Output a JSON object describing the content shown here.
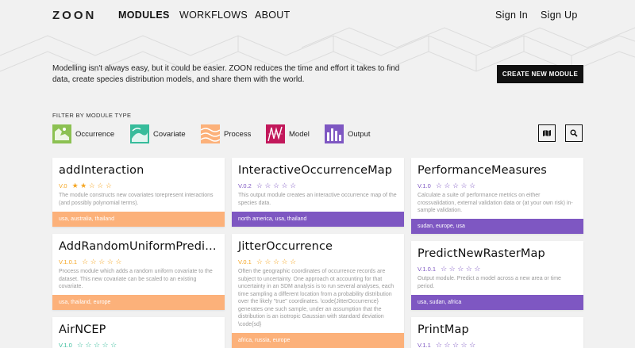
{
  "brand": "ZOON",
  "nav": {
    "modules": "MODULES",
    "workflows": "WORKFLOWS",
    "about": "ABOUT",
    "sign_in": "Sign In",
    "sign_up": "Sign Up"
  },
  "intro": "Modelling isn't always easy, but it could be easier. ZOON reduces the time and effort it takes to find data, create species distribution models, and share them with the world.",
  "create_button": "CREATE NEW MODULE",
  "filter": {
    "title": "FILTER BY MODULE TYPE",
    "types": [
      {
        "label": "Occurrence",
        "color": "#8cc152",
        "icon": "occurrence-icon"
      },
      {
        "label": "Covariate",
        "color": "#37bc9b",
        "icon": "covariate-icon"
      },
      {
        "label": "Process",
        "color": "#fcb17a",
        "icon": "process-icon"
      },
      {
        "label": "Model",
        "color": "#c2185b",
        "icon": "model-icon"
      },
      {
        "label": "Output",
        "color": "#7e57c2",
        "icon": "output-icon"
      }
    ]
  },
  "tools": {
    "map_icon": "map-icon",
    "search_icon": "search-icon"
  },
  "colors": {
    "process": "#fcb17a",
    "output": "#7e57c2",
    "star_process": "#f5a623",
    "star_output": "#7e57c2",
    "star_covariate": "#37bc9b"
  },
  "cards": [
    {
      "title": "addInteraction",
      "version": "V.0",
      "stars": "★★☆☆☆",
      "description": "The module constructs new covariates torepresent interactions (and possibly polynomial terms).",
      "tags": "usa, australia, thailand"
    },
    {
      "title": "AddRandomUniformPredi…",
      "version": "V.1.0.1",
      "stars": "☆☆☆☆☆",
      "description": "Process module which adds a random uniform covariate to the dataset. This new covariate can be scaled to an existing covariate.",
      "tags": "usa, thailand, europe"
    },
    {
      "title": "AirNCEP",
      "version": "V.1.0",
      "stars": "☆☆☆☆☆",
      "description": "",
      "tags": ""
    },
    {
      "title": "InteractiveOccurrenceMap",
      "version": "V.0.2",
      "stars": "☆☆☆☆☆",
      "description": "This output module creates an interactive occurrence map of the species data.",
      "tags": "north america, usa, thailand"
    },
    {
      "title": "JitterOccurrence",
      "version": "V.0.1",
      "stars": "☆☆☆☆☆",
      "description": "Often the geographic coordinates of occurrence records are subject to uncertainty. One approach ot accounting for that uncertainty in an SDM analysis is to run several analyses, each time sampling a different location from a probability distribution over the likely \"true\" coordinates. \\code{JitterOccurrence} generates one such sample, under an assumption that the distribution is an isotropic Gaussian with standard deviation \\code{sd}",
      "tags": "africa, russia, europe"
    },
    {
      "title": "PerformanceMeasures",
      "version": "V.1.0",
      "stars": "☆☆☆☆☆",
      "description": "Calculate a suite of performance metrics on either crossvalidation, external validation data or (at your own risk) in-sample validation.",
      "tags": "sudan, europe, usa"
    },
    {
      "title": "PredictNewRasterMap",
      "version": "V.1.0.1",
      "stars": "☆☆☆☆☆",
      "description": "Output module. Predict a model across a new area or time period.",
      "tags": "usa, sudan, africa"
    },
    {
      "title": "PrintMap",
      "version": "V.1.1",
      "stars": "☆☆☆☆☆",
      "description": "",
      "tags": ""
    }
  ]
}
